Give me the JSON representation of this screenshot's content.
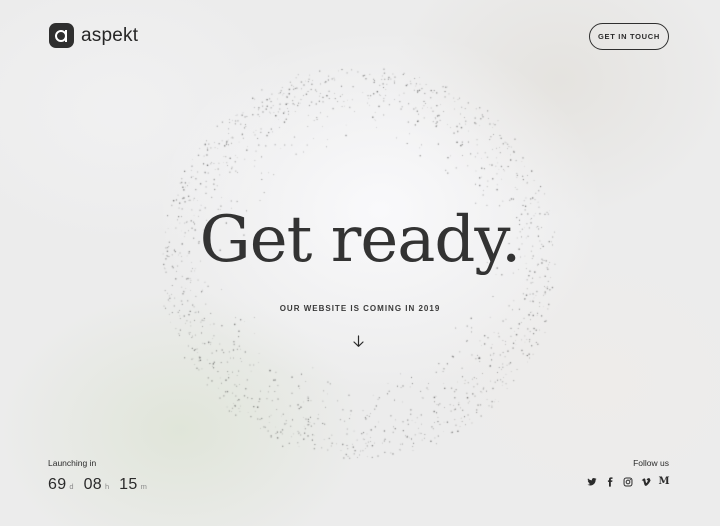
{
  "brand": {
    "name": "aspekt",
    "logo_icon": "aspekt-logo-icon",
    "accent": "#2f2f2f"
  },
  "header": {
    "cta_label": "GET IN TOUCH"
  },
  "hero": {
    "title": "Get ready.",
    "subtitle": "OUR WEBSITE IS COMING IN 2019",
    "scroll_icon": "arrow-down-icon"
  },
  "countdown": {
    "label": "Launching in",
    "days": "69",
    "days_unit": "d",
    "hours": "08",
    "hours_unit": "h",
    "minutes": "15",
    "minutes_unit": "m"
  },
  "social": {
    "label": "Follow us",
    "icons": [
      "twitter-icon",
      "facebook-icon",
      "instagram-icon",
      "vimeo-icon",
      "medium-icon"
    ],
    "medium_glyph": "M"
  },
  "colors": {
    "text": "#2b2b2b",
    "background": "#ececec",
    "muted": "#8a8a8a"
  }
}
